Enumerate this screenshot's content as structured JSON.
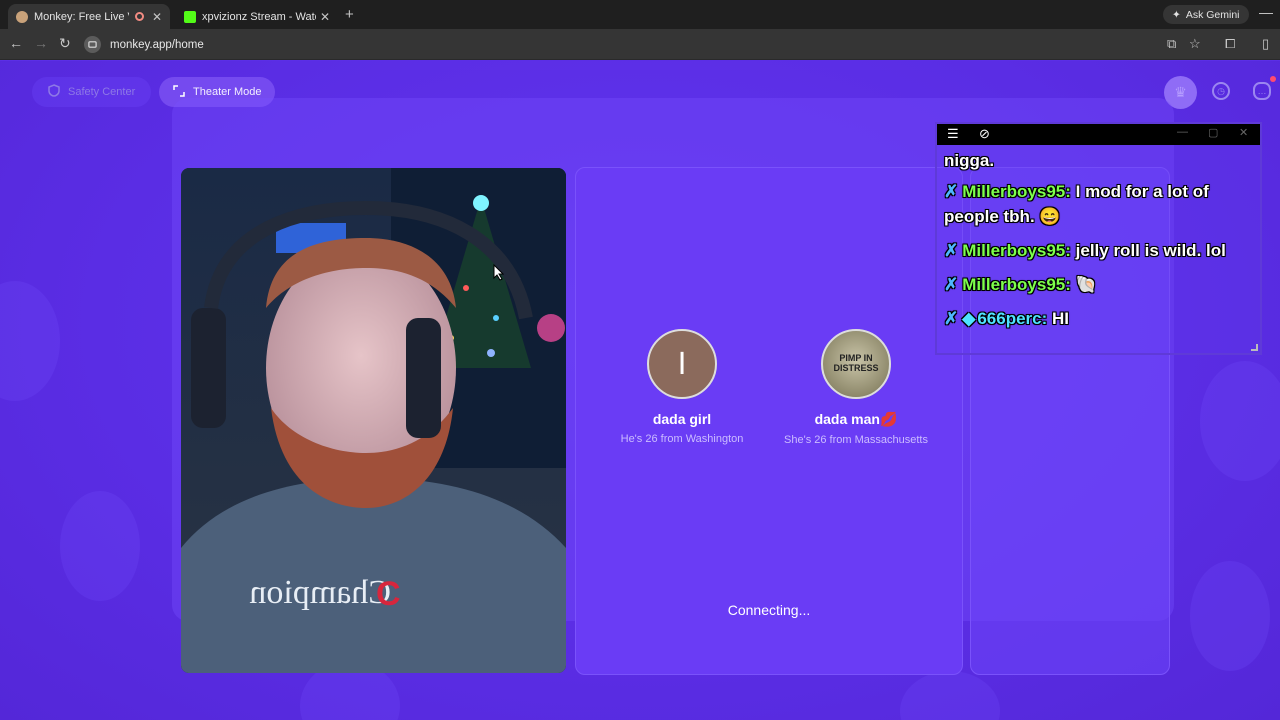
{
  "browser": {
    "tabs": [
      {
        "title": "Monkey: Free Live Video Ch",
        "active": true,
        "favicon_color": "#c9a27a"
      },
      {
        "title": "xpvizionz Stream - Watch Live",
        "active": false,
        "favicon_color": "#53fc18"
      }
    ],
    "new_tab": "+",
    "ask_gemini": "Ask Gemini",
    "minimize": "—",
    "url": "monkey.app/home"
  },
  "header": {
    "safety_center": "Safety Center",
    "theater_mode": "Theater Mode"
  },
  "matches": [
    {
      "initial": "I",
      "name": "dada girl",
      "info": "He's 26 from Washington"
    },
    {
      "photo_text": "PIMP IN DISTRESS",
      "name": "dada man💋",
      "info": "She's 26 from Massachusetts"
    }
  ],
  "status": "Connecting...",
  "chat": {
    "lines": [
      {
        "user": "",
        "text": "nigga."
      },
      {
        "user": "Millerboys95:",
        "text": "I mod for a lot of people tbh. 😄"
      },
      {
        "user": "Millerboys95:",
        "text": "jelly roll is wild. lol"
      },
      {
        "user": "Millerboys95:",
        "text": "🐚"
      },
      {
        "user": "666perc:",
        "text": "HI"
      }
    ]
  },
  "colors": {
    "page_bg": "#5b2fe6",
    "panel": "#6a3cf5",
    "chat_username": "#7dff4c",
    "chat_username_alt": "#4fe3ff"
  }
}
